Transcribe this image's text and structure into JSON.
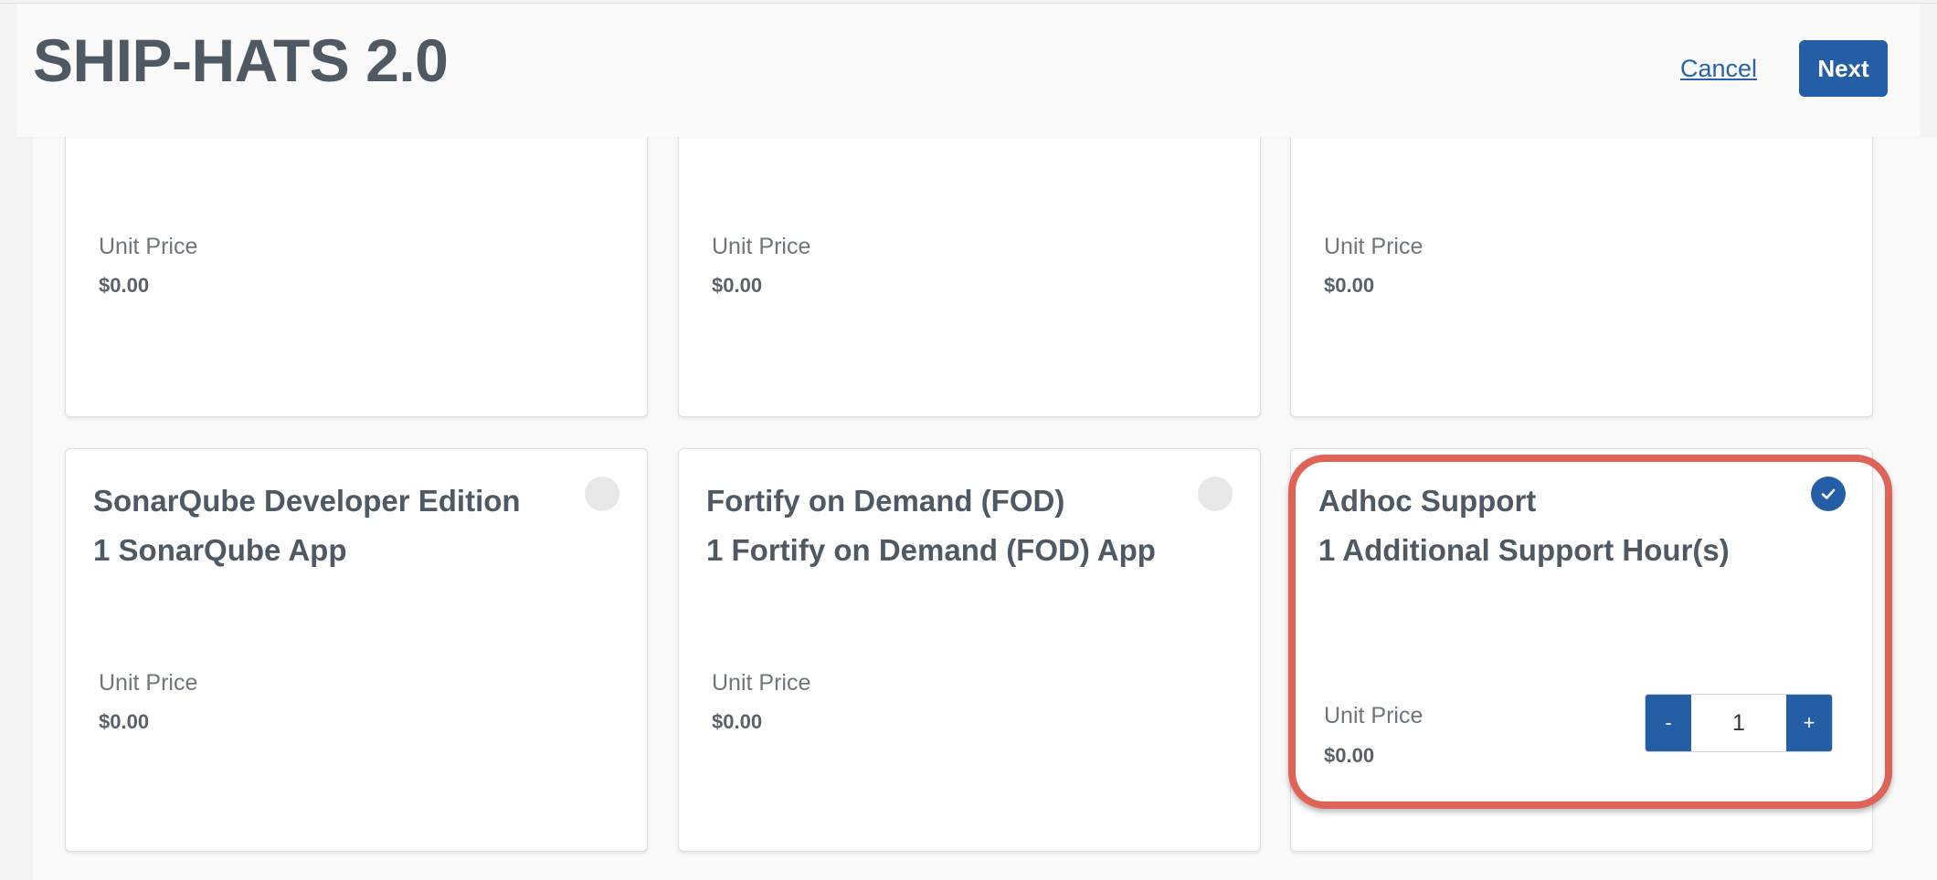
{
  "header": {
    "title": "SHIP-HATS 2.0",
    "cancel_label": "Cancel",
    "next_label": "Next"
  },
  "top_cards": [
    {
      "unit_label": "Unit Price",
      "price": "$0.00"
    },
    {
      "unit_label": "Unit Price",
      "price": "$0.00"
    },
    {
      "unit_label": "Unit Price",
      "price": "$0.00"
    }
  ],
  "cards": [
    {
      "title": "SonarQube Developer Edition",
      "subtitle": "1 SonarQube App",
      "unit_label": "Unit Price",
      "price": "$0.00",
      "selected": false
    },
    {
      "title": "Fortify on Demand (FOD)",
      "subtitle": "1 Fortify on Demand (FOD) App",
      "unit_label": "Unit Price",
      "price": "$0.00",
      "selected": false
    },
    {
      "title": "Adhoc Support",
      "subtitle": "1 Additional Support Hour(s)",
      "unit_label": "Unit Price",
      "price": "$0.00",
      "selected": true,
      "quantity": "1",
      "decrement_label": "-",
      "increment_label": "+"
    }
  ],
  "colors": {
    "accent": "#245ea6",
    "highlight": "#e06358",
    "title_text": "#4f5963"
  },
  "icons": {
    "selected": "check-icon"
  }
}
